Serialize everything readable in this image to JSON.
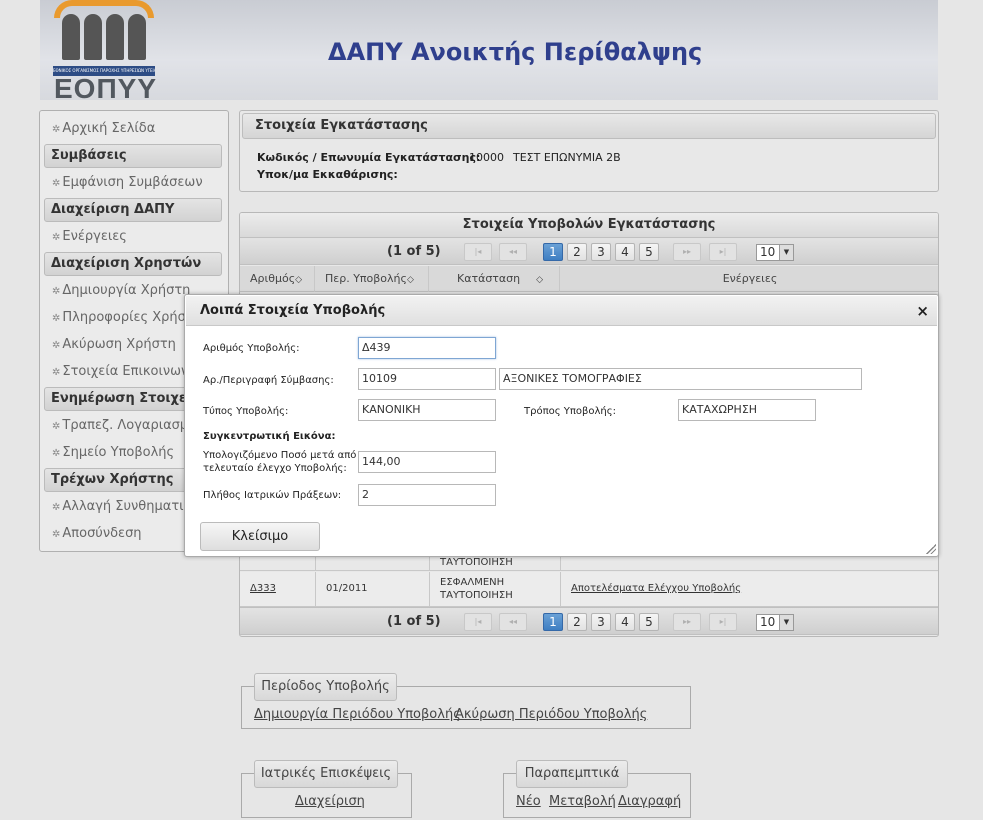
{
  "header": {
    "logo_band_text": "ΕΘΝΙΚΟΣ ΟΡΓΑΝΙΣΜΟΣ ΠΑΡΟΧΗΣ ΥΠΗΡΕΣΙΩΝ ΥΓΕΙΑΣ",
    "logo_word": "ΕΟΠΥΥ",
    "title": "ΔΑΠΥ Ανοικτής Περίθαλψης"
  },
  "sidebar": {
    "home": "Αρχική Σελίδα",
    "sec_contracts": "Συμβάσεις",
    "show_contracts": "Εμφάνιση Συμβάσεων",
    "sec_dapy": "Διαχείριση ΔΑΠΥ",
    "actions": "Ενέργειες",
    "sec_users": "Διαχείριση Χρηστών",
    "create_user": "Δημιουργία Χρήστη",
    "user_info": "Πληροφορίες Χρήστη",
    "cancel_user": "Ακύρωση Χρήστη",
    "contact": "Στοιχεία Επικοινωνίας",
    "sec_update": "Ενημέρωση Στοιχείων",
    "bank": "Τραπεζ. Λογαριασμοί",
    "submit_point": "Σημείο Υποβολής",
    "sec_current": "Τρέχων Χρήστης",
    "change_pwd": "Αλλαγή Συνθηματικού",
    "logout": "Αποσύνδεση"
  },
  "install": {
    "title": "Στοιχεία Εγκατάστασης",
    "code_label": "Κωδικός / Επωνυμία Εγκατάστασης:",
    "code_value": "10000",
    "name_value": "ΤΕΣΤ ΕΠΩΝΥΜΙΑ 2Β",
    "sub_label": "Υποκ/μα Εκκαθάρισης:"
  },
  "submissions": {
    "title": "Στοιχεία Υποβολών Εγκατάστασης",
    "page_count": "(1 of 5)",
    "pages": [
      "1",
      "2",
      "3",
      "4",
      "5"
    ],
    "first": "|◂",
    "prev": "◂◂",
    "next": "▸▸",
    "last": "▸|",
    "per_page": "10",
    "columns": [
      "Αριθμός",
      "Περ. Υποβολής",
      "Κατάσταση",
      "Ενέργειες"
    ],
    "partial_row_status": "ΤΑΥΤΟΠΟΙΗΣΗ",
    "row": {
      "number": "Δ333",
      "period": "01/2011",
      "status_line1": "ΕΣΦΑΛΜΕΝΗ",
      "status_line2": "ΤΑΥΤΟΠΟΙΗΣΗ",
      "action": "Αποτελέσματα Ελέγχου Υποβολής"
    }
  },
  "modal": {
    "title": "Λοιπά Στοιχεία Υποβολής",
    "close_x": "×",
    "f_number_label": "Αριθμός Υποβολής:",
    "f_number_value": "Δ439",
    "f_contract_label": "Αρ./Περιγραφή Σύμβασης:",
    "f_contract_value": "10109",
    "f_contract_desc": "ΑΞΟΝΙΚΕΣ ΤΟΜΟΓΡΑΦΙΕΣ",
    "f_type_label": "Τύπος Υποβολής:",
    "f_type_value": "ΚΑΝΟΝΙΚΗ",
    "f_method_label": "Τρόπος Υποβολής:",
    "f_method_value": "ΚΑΤΑΧΩΡΗΣΗ",
    "summary_label": "Συγκεντρωτική Εικόνα:",
    "f_amount_label_1": "Υπολογιζόμενο Ποσό μετά από",
    "f_amount_label_2": "τελευταίο έλεγχο Υποβολής:",
    "f_amount_value": "144,00",
    "f_acts_label": "Πλήθος Ιατρικών Πράξεων:",
    "f_acts_value": "2",
    "close_button": "Κλείσιμο"
  },
  "period": {
    "legend": "Περίοδος Υποβολής",
    "create": "Δημιουργία Περιόδου Υποβολής",
    "cancel": "Ακύρωση Περιόδου Υποβολής"
  },
  "visits": {
    "legend": "Ιατρικές Επισκέψεις",
    "manage": "Διαχείριση"
  },
  "referrals": {
    "legend": "Παραπεμπτικά",
    "new": "Νέο",
    "edit": "Μεταβολή",
    "delete": "Διαγραφή"
  }
}
